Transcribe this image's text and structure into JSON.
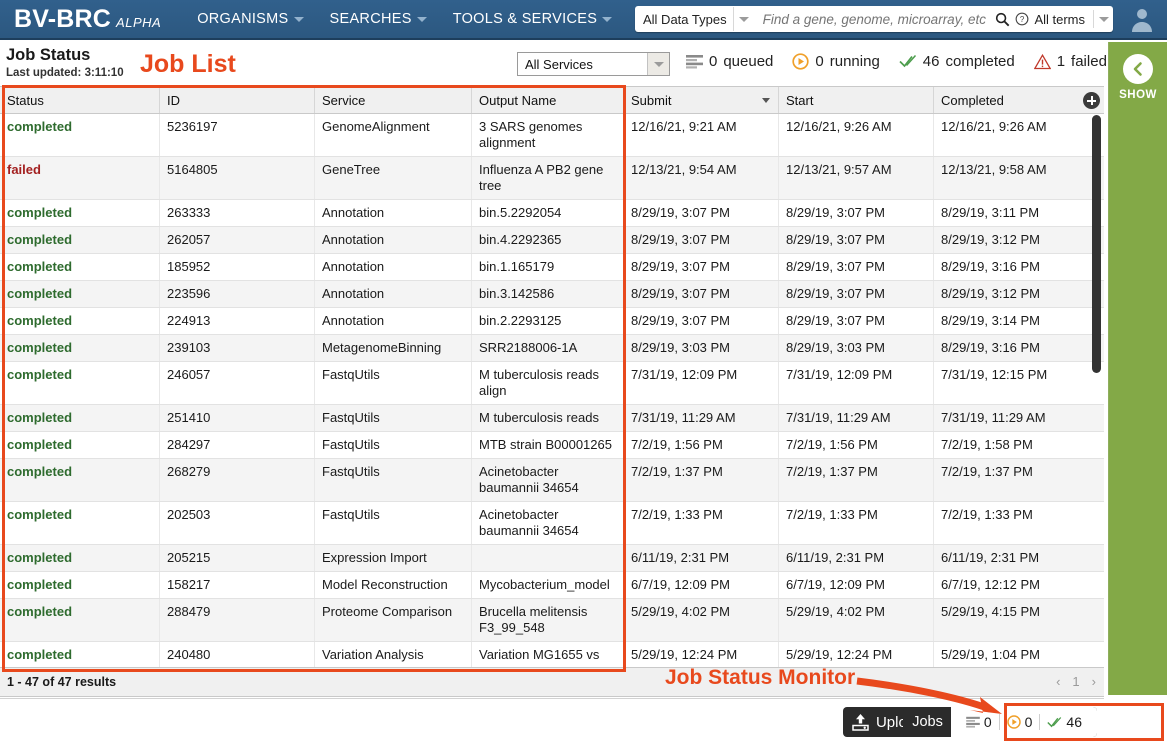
{
  "header": {
    "brand": "BV-BRC",
    "brand_alpha": "ALPHA",
    "nav": [
      {
        "label": "ORGANISMS",
        "icon": "chevron-down-icon"
      },
      {
        "label": "SEARCHES",
        "icon": "chevron-down-icon"
      },
      {
        "label": "TOOLS & SERVICES",
        "icon": "chevron-down-icon"
      }
    ],
    "search": {
      "data_type": "All Data Types",
      "placeholder": "Find a gene, genome, microarray, etc",
      "value": "",
      "terms_label": "All terms",
      "search_icon": "search-icon",
      "help_icon": "question-circle-icon"
    },
    "account_icon": "user-avatar-icon"
  },
  "jobstatus": {
    "title": "Job Status",
    "last_updated": "Last updated: 3:11:10",
    "service_filter": "All Services",
    "counters": [
      {
        "icon": "queue-icon",
        "count": "0",
        "label": "queued",
        "color": "#8a8a8a"
      },
      {
        "icon": "play-circle-icon",
        "count": "0",
        "label": "running",
        "color": "#f0a02a"
      },
      {
        "icon": "double-check-icon",
        "count": "46",
        "label": "completed",
        "color": "#4d9d4d"
      },
      {
        "icon": "warning-triangle-icon",
        "count": "1",
        "label": "failed",
        "color": "#c0392b"
      }
    ]
  },
  "table": {
    "columns": [
      "Status",
      "ID",
      "Service",
      "Output Name",
      "Submit",
      "Start",
      "Completed"
    ],
    "sorted_column": "Submit",
    "add_column_icon": "plus-circle-icon",
    "rows": [
      {
        "status": "completed",
        "id": "5236197",
        "service": "GenomeAlignment",
        "output": "3 SARS genomes alignment",
        "submit": "12/16/21, 9:21 AM",
        "start": "12/16/21, 9:26 AM",
        "completed": "12/16/21, 9:26 AM"
      },
      {
        "status": "failed",
        "id": "5164805",
        "service": "GeneTree",
        "output": "Influenza A PB2 gene tree",
        "submit": "12/13/21, 9:54 AM",
        "start": "12/13/21, 9:57 AM",
        "completed": "12/13/21, 9:58 AM"
      },
      {
        "status": "completed",
        "id": "263333",
        "service": "Annotation",
        "output": "bin.5.2292054",
        "submit": "8/29/19, 3:07 PM",
        "start": "8/29/19, 3:07 PM",
        "completed": "8/29/19, 3:11 PM"
      },
      {
        "status": "completed",
        "id": "262057",
        "service": "Annotation",
        "output": "bin.4.2292365",
        "submit": "8/29/19, 3:07 PM",
        "start": "8/29/19, 3:07 PM",
        "completed": "8/29/19, 3:12 PM"
      },
      {
        "status": "completed",
        "id": "185952",
        "service": "Annotation",
        "output": "bin.1.165179",
        "submit": "8/29/19, 3:07 PM",
        "start": "8/29/19, 3:07 PM",
        "completed": "8/29/19, 3:16 PM"
      },
      {
        "status": "completed",
        "id": "223596",
        "service": "Annotation",
        "output": "bin.3.142586",
        "submit": "8/29/19, 3:07 PM",
        "start": "8/29/19, 3:07 PM",
        "completed": "8/29/19, 3:12 PM"
      },
      {
        "status": "completed",
        "id": "224913",
        "service": "Annotation",
        "output": "bin.2.2293125",
        "submit": "8/29/19, 3:07 PM",
        "start": "8/29/19, 3:07 PM",
        "completed": "8/29/19, 3:14 PM"
      },
      {
        "status": "completed",
        "id": "239103",
        "service": "MetagenomeBinning",
        "output": "SRR2188006-1A",
        "submit": "8/29/19, 3:03 PM",
        "start": "8/29/19, 3:03 PM",
        "completed": "8/29/19, 3:16 PM"
      },
      {
        "status": "completed",
        "id": "246057",
        "service": "FastqUtils",
        "output": "M tuberculosis reads align",
        "submit": "7/31/19, 12:09 PM",
        "start": "7/31/19, 12:09 PM",
        "completed": "7/31/19, 12:15 PM"
      },
      {
        "status": "completed",
        "id": "251410",
        "service": "FastqUtils",
        "output": "M tuberculosis reads",
        "submit": "7/31/19, 11:29 AM",
        "start": "7/31/19, 11:29 AM",
        "completed": "7/31/19, 11:29 AM"
      },
      {
        "status": "completed",
        "id": "284297",
        "service": "FastqUtils",
        "output": "MTB strain B00001265",
        "submit": "7/2/19, 1:56 PM",
        "start": "7/2/19, 1:56 PM",
        "completed": "7/2/19, 1:58 PM"
      },
      {
        "status": "completed",
        "id": "268279",
        "service": "FastqUtils",
        "output": "Acinetobacter baumannii 34654",
        "submit": "7/2/19, 1:37 PM",
        "start": "7/2/19, 1:37 PM",
        "completed": "7/2/19, 1:37 PM"
      },
      {
        "status": "completed",
        "id": "202503",
        "service": "FastqUtils",
        "output": "Acinetobacter baumannii 34654",
        "submit": "7/2/19, 1:33 PM",
        "start": "7/2/19, 1:33 PM",
        "completed": "7/2/19, 1:33 PM"
      },
      {
        "status": "completed",
        "id": "205215",
        "service": "Expression Import",
        "output": "",
        "submit": "6/11/19, 2:31 PM",
        "start": "6/11/19, 2:31 PM",
        "completed": "6/11/19, 2:31 PM"
      },
      {
        "status": "completed",
        "id": "158217",
        "service": "Model Reconstruction",
        "output": "Mycobacterium_model",
        "submit": "6/7/19, 12:09 PM",
        "start": "6/7/19, 12:09 PM",
        "completed": "6/7/19, 12:12 PM"
      },
      {
        "status": "completed",
        "id": "288479",
        "service": "Proteome Comparison",
        "output": "Brucella melitensis F3_99_548",
        "submit": "5/29/19, 4:02 PM",
        "start": "5/29/19, 4:02 PM",
        "completed": "5/29/19, 4:15 PM"
      },
      {
        "status": "completed",
        "id": "240480",
        "service": "Variation Analysis",
        "output": "Variation MG1655 vs",
        "submit": "5/29/19, 12:24 PM",
        "start": "5/29/19, 12:24 PM",
        "completed": "5/29/19, 1:04 PM"
      }
    ],
    "results_text": "1 - 47 of 47 results",
    "pager": {
      "prev": "‹",
      "page": "1",
      "next": "›"
    }
  },
  "dock": {
    "uploads_label": "Uploads",
    "uploads_icon": "upload-icon",
    "jobs_label": "Jobs",
    "jobs_counts": [
      {
        "icon": "queue-icon",
        "count": "0"
      },
      {
        "icon": "play-circle-icon",
        "count": "0"
      },
      {
        "icon": "double-check-icon",
        "count": "46"
      }
    ]
  },
  "rightpanel": {
    "show_label": "SHOW",
    "toggle_icon": "chevron-left-icon"
  },
  "annotations": {
    "job_list": "Job List",
    "job_status_monitor": "Job Status Monitor",
    "color": "#e8491d"
  }
}
